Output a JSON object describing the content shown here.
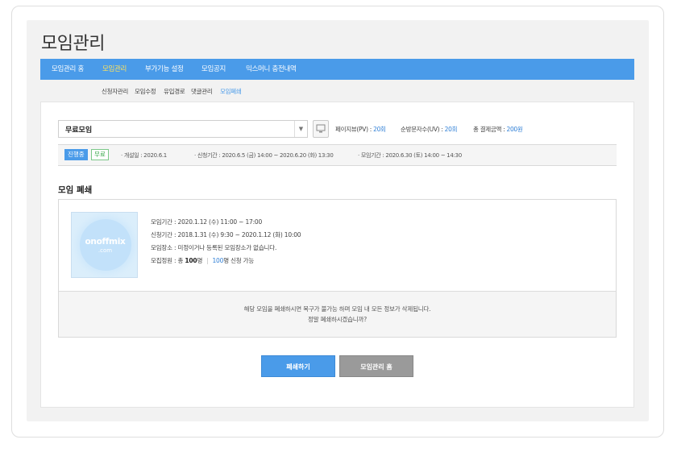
{
  "page": {
    "title": "모임관리"
  },
  "nav": {
    "items": [
      {
        "label": "모임관리 홈",
        "active": false
      },
      {
        "label": "모임관리",
        "active": true
      },
      {
        "label": "부가기능 설정",
        "active": false
      },
      {
        "label": "모임공지",
        "active": false
      },
      {
        "label": "믹스머니 충전내역",
        "active": false
      }
    ]
  },
  "subnav": {
    "items": [
      {
        "label": "신청자관리",
        "active": false
      },
      {
        "label": "모임수정",
        "active": false
      },
      {
        "label": "유입경로",
        "active": false
      },
      {
        "label": "댓글관리",
        "active": false
      },
      {
        "label": "모임폐쇄",
        "active": true
      }
    ]
  },
  "event_select": {
    "value": "무료모임",
    "arrow_icon": "triangle-down"
  },
  "stats": {
    "pageviews_label": "페이지뷰(PV) : ",
    "pageviews_value": "20회",
    "visitors_label": "순방문자수(UV) : ",
    "visitors_value": "20회",
    "payment_label": "총 결제금액 : ",
    "payment_value": "200원"
  },
  "info_bar": {
    "status_badge": "진행중",
    "price_badge": "무료",
    "opened": "· 개설일 : 2020.6.1",
    "apply_period": "· 신청기간 : 2020.6.5 (금) 14:00 ~ 2020.6.20 (화) 13:30",
    "event_period": "· 모임기간 : 2020.6.30 (토) 14:00 ~ 14:30"
  },
  "section": {
    "title": "모임 폐쇄"
  },
  "event_detail": {
    "thumbnail_logo": "onoffmix",
    "thumbnail_sub": ".com",
    "event_period": "모임기간 : 2020.1.12 (수) 11:00 ~ 17:00",
    "apply_period": "신청기간 : 2018.1.31 (수) 9:30 ~ 2020.1.12 (화) 10:00",
    "location": "모임장소 : 미정이거나 등록된 모임장소가 없습니다.",
    "capacity_label": "모집정원 : 총 ",
    "capacity_total": "100",
    "capacity_unit": "명",
    "separator": "|",
    "capacity_open": "100",
    "capacity_open_suffix": "명 신청 가능"
  },
  "warning": {
    "line1": "해당 모임을 폐쇄하시면 복구가 불가능 하며 모임 내 모든 정보가 삭제됩니다.",
    "line2": "정말 폐쇄하시겠습니까?"
  },
  "buttons": {
    "close": "폐쇄하기",
    "home": "모임관리 홈"
  },
  "colors": {
    "accent": "#4a9be9",
    "nav_active": "#ffe25c",
    "link": "#2f7fd6",
    "free_badge": "#3aa84b",
    "secondary_button": "#9a9a9a"
  }
}
